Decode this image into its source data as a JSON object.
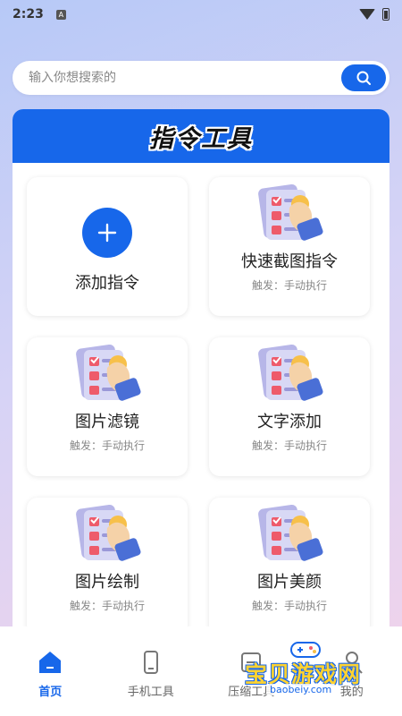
{
  "status": {
    "time": "2:23",
    "app_icon_letter": "A"
  },
  "search": {
    "placeholder": "输入你想搜索的"
  },
  "panel": {
    "title": "指令工具"
  },
  "add_card": {
    "label": "添加指令"
  },
  "cards": [
    {
      "name": "快速截图指令",
      "trigger": "触发：手动执行"
    },
    {
      "name": "图片滤镜",
      "trigger": "触发：手动执行"
    },
    {
      "name": "文字添加",
      "trigger": "触发：手动执行"
    },
    {
      "name": "图片绘制",
      "trigger": "触发：手动执行"
    },
    {
      "name": "图片美颜",
      "trigger": "触发：手动执行"
    }
  ],
  "nav": [
    {
      "label": "首页",
      "icon": "home-icon",
      "active": true
    },
    {
      "label": "手机工具",
      "icon": "phone-icon",
      "active": false
    },
    {
      "label": "压缩工具",
      "icon": "compress-icon",
      "active": false
    },
    {
      "label": "我的",
      "icon": "user-icon",
      "active": false
    }
  ],
  "watermark": {
    "text": "宝贝游戏网",
    "url": "baobeiy.com"
  },
  "colors": {
    "accent": "#1767ea",
    "background_top": "#b7c9f7",
    "background_bottom": "#f3d3ea"
  }
}
